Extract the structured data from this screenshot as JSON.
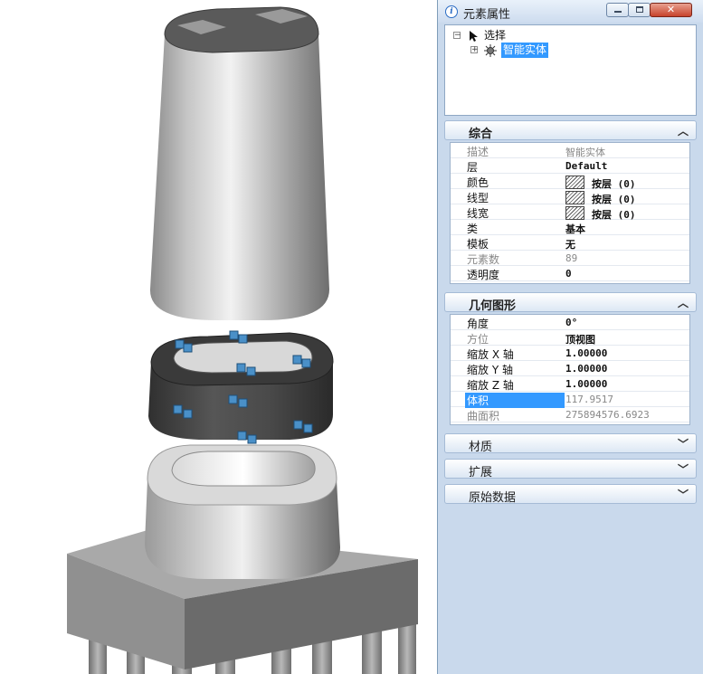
{
  "panel": {
    "title": "元素属性",
    "info_icon": "i",
    "window_buttons": {
      "minimize": "minimize-icon",
      "maximize": "maximize-icon",
      "close": "close-icon"
    }
  },
  "tree": {
    "root": {
      "expander": "−",
      "label": "选择",
      "icon": "cursor-arrow-icon"
    },
    "child": {
      "expander": "+",
      "label": "智能实体",
      "icon": "smart-solid-icon"
    }
  },
  "sections": {
    "general": {
      "title": "综合",
      "rows": [
        {
          "name": "描述",
          "value": "智能实体",
          "dim_name": true,
          "dim_value": true
        },
        {
          "name": "层",
          "value": "Default"
        },
        {
          "name": "颜色",
          "value": "按层 (0)",
          "swatch": true
        },
        {
          "name": "线型",
          "value": "按层 (0)",
          "swatch": true
        },
        {
          "name": "线宽",
          "value": "按层 (0)",
          "swatch": true
        },
        {
          "name": "类",
          "value": "基本"
        },
        {
          "name": "模板",
          "value": "无"
        },
        {
          "name": "元素数",
          "value": "89",
          "dim_name": true,
          "dim_value": true
        },
        {
          "name": "透明度",
          "value": "0"
        }
      ]
    },
    "geometry": {
      "title": "几何图形",
      "rows": [
        {
          "name": "角度",
          "value": "0°"
        },
        {
          "name": "方位",
          "value": "顶视图",
          "dim_name": true
        },
        {
          "name": "缩放 X 轴",
          "value": "1.00000"
        },
        {
          "name": "缩放 Y 轴",
          "value": "1.00000"
        },
        {
          "name": "缩放 Z 轴",
          "value": "1.00000"
        },
        {
          "name": "体积",
          "value": "117.9517",
          "selected": true,
          "dim_value": true
        },
        {
          "name": "曲面积",
          "value": "275894576.6923",
          "dim_name": true,
          "dim_value": true
        }
      ]
    },
    "material": {
      "title": "材质"
    },
    "extension": {
      "title": "扩展"
    },
    "raw_data": {
      "title": "原始数据"
    }
  },
  "colors": {
    "panel_bg": "#c9d9ec",
    "selection": "#3399ff",
    "handle": "#4a90c8"
  }
}
